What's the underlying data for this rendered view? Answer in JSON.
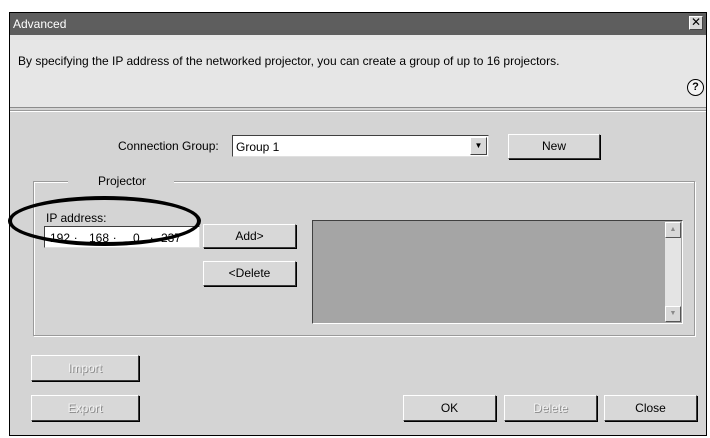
{
  "window": {
    "title": "Advanced",
    "close_glyph": "✕"
  },
  "header": {
    "description": "By specifying the IP address of the networked projector, you can create a group of up to 16 projectors.",
    "help_glyph": "?"
  },
  "connection_group": {
    "label": "Connection Group:",
    "value": "Group 1",
    "new_button": "New"
  },
  "projector_group": {
    "title": "Projector",
    "ip_label": "IP address:",
    "ip_octets": [
      "192",
      "168",
      "0",
      "237"
    ],
    "add_button": "Add>",
    "delete_button": "<Delete",
    "list_items": []
  },
  "footer": {
    "import_button": "Import",
    "export_button": "Export",
    "ok_button": "OK",
    "delete_button": "Delete",
    "close_button": "Close"
  },
  "icons": {
    "combo_arrow": "▼",
    "scroll_up": "▲",
    "scroll_down": "▼"
  }
}
